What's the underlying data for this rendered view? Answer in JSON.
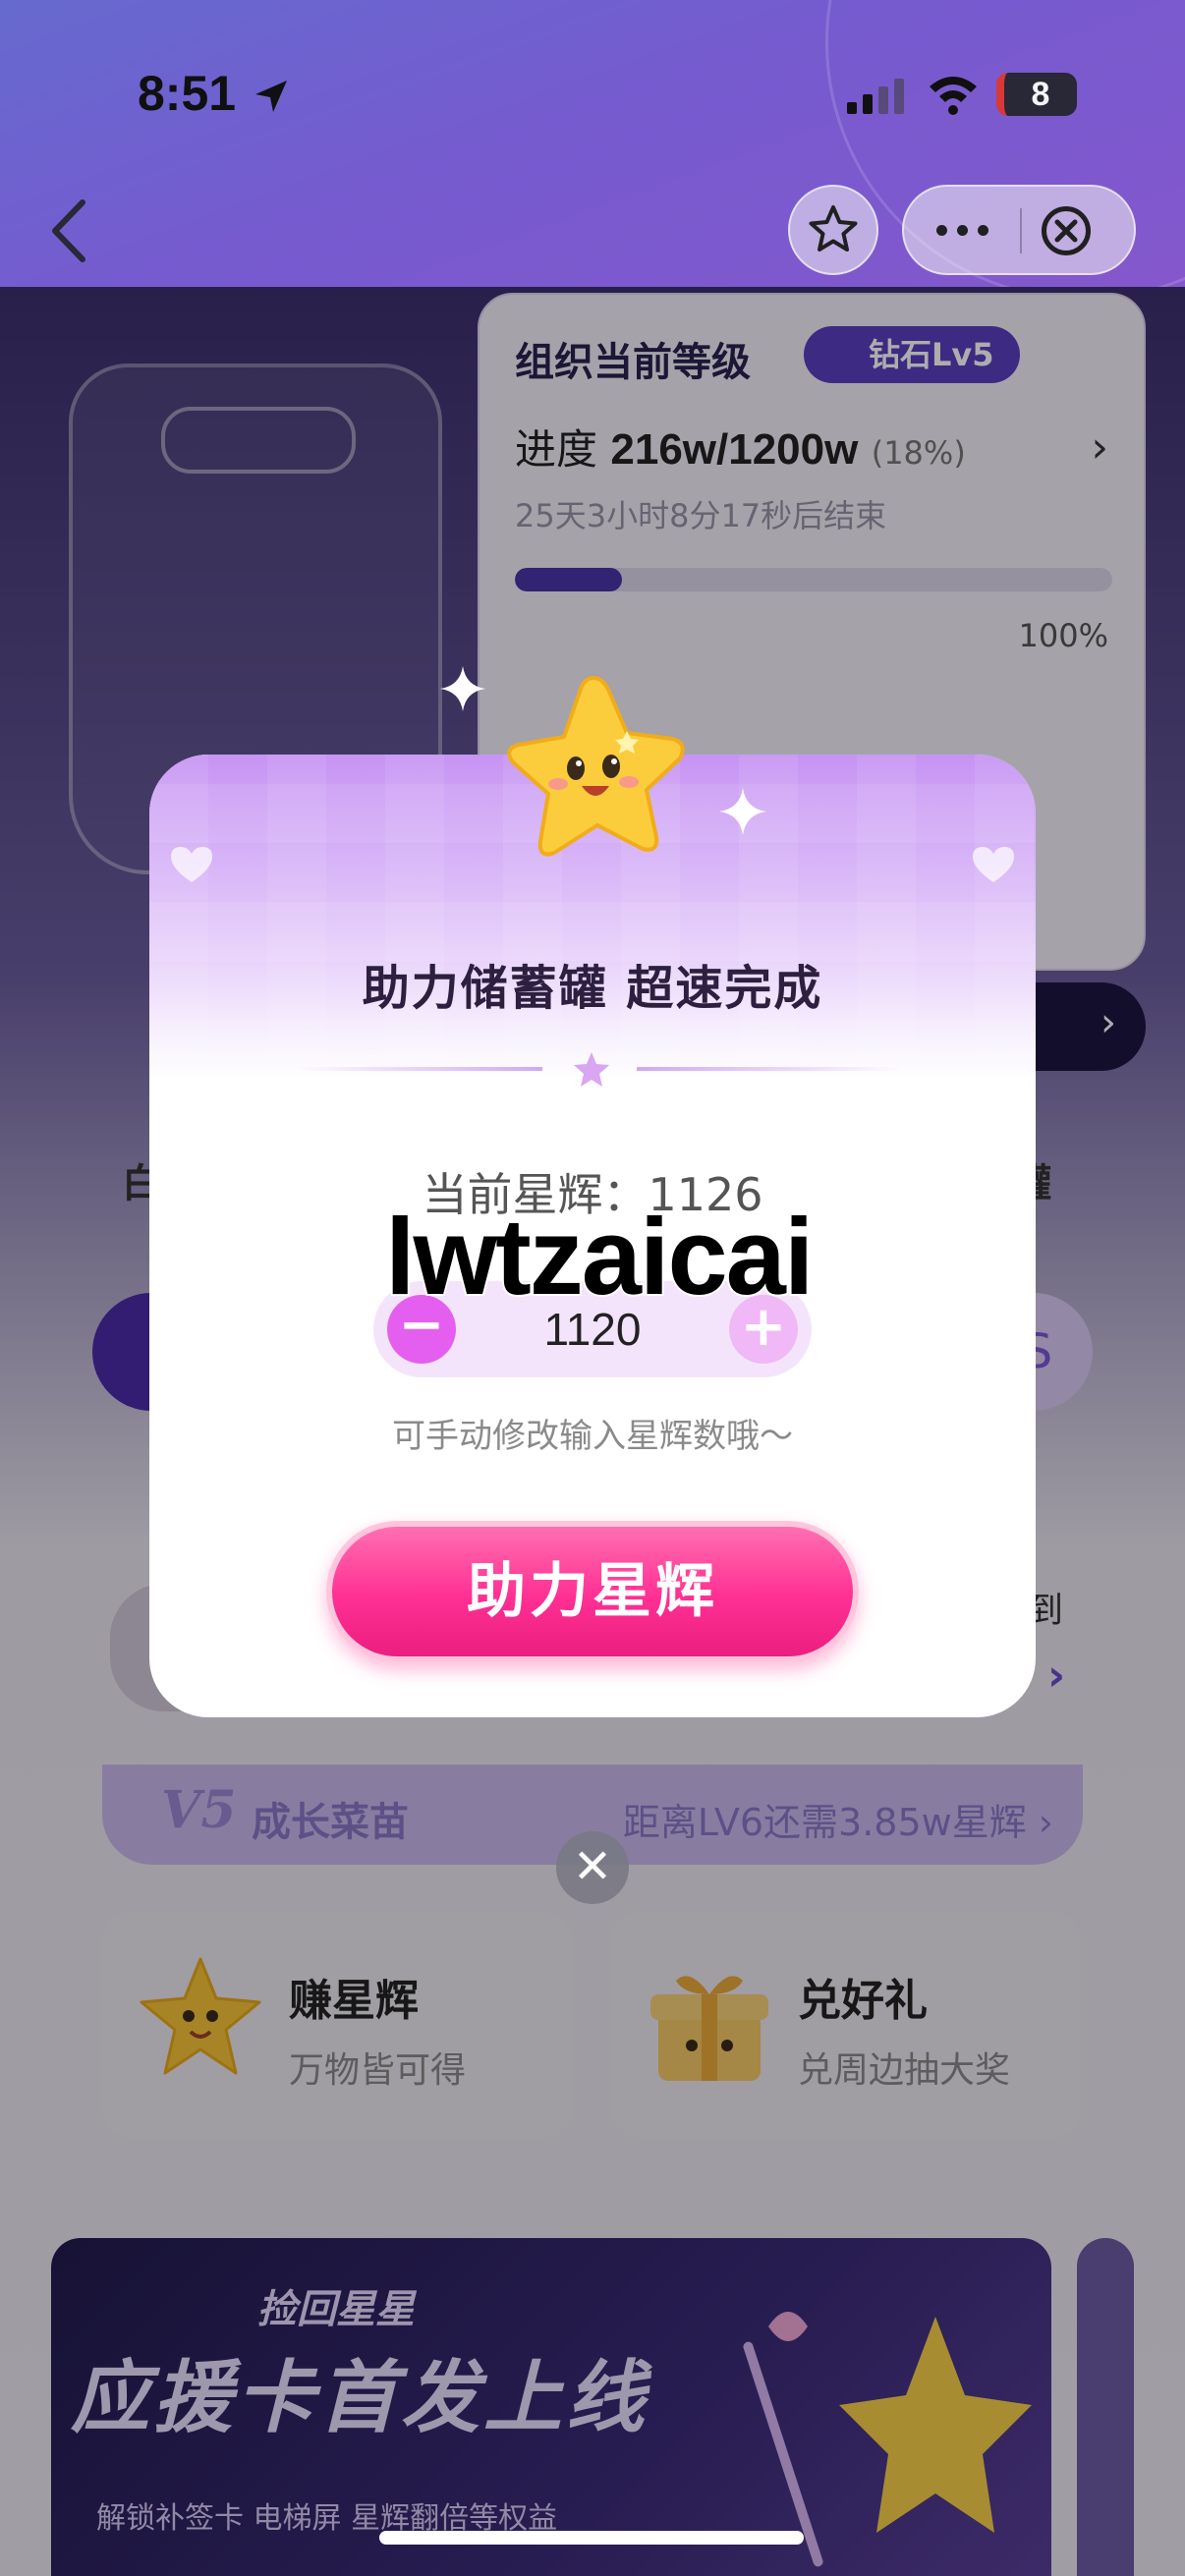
{
  "status_bar": {
    "time": "8:51",
    "battery": "8"
  },
  "nav": {
    "back_icon": "chevron-left-icon",
    "favorite_icon": "star-outline-icon",
    "more_icon": "more-dots-icon",
    "close_icon": "close-circle-icon"
  },
  "level_card": {
    "title": "组织当前等级",
    "badge": "钻石Lv5",
    "progress_label": "进度",
    "progress_value": "216w/1200w",
    "progress_percent": "(18%)",
    "progress_fraction": 0.18,
    "countdown": "25天3小时8分17秒后结束",
    "target": "100%"
  },
  "background": {
    "left_label": "白",
    "right_label": "罐",
    "checkin_label": "签到",
    "v5_badge": "V5",
    "v5_name": "成长菜苗",
    "v5_next": "距离LV6还需3.85w星辉 ›",
    "earn_title": "赚星辉",
    "earn_sub": "万物皆可得",
    "redeem_title": "兑好礼",
    "redeem_sub": "兑周边抽大奖",
    "promo_kicker": "捡回星星",
    "promo_title": "应援卡首发上线",
    "promo_sub": "解锁补签卡 电梯屏 星辉翻倍等权益"
  },
  "modal": {
    "title": "助力储蓄罐  超速完成",
    "balance": "当前星辉：1126",
    "watermark": "lwtzaicai",
    "amount": "1120",
    "minus_label": "−",
    "plus_label": "+",
    "hint": "可手动修改输入星辉数哦～",
    "confirm_label": "助力星辉",
    "close_label": "✕"
  },
  "colors": {
    "accent_purple": "#5b3fc0",
    "confirm_pink": "#ff2f93",
    "stepper_pink": "#e45ff0"
  }
}
